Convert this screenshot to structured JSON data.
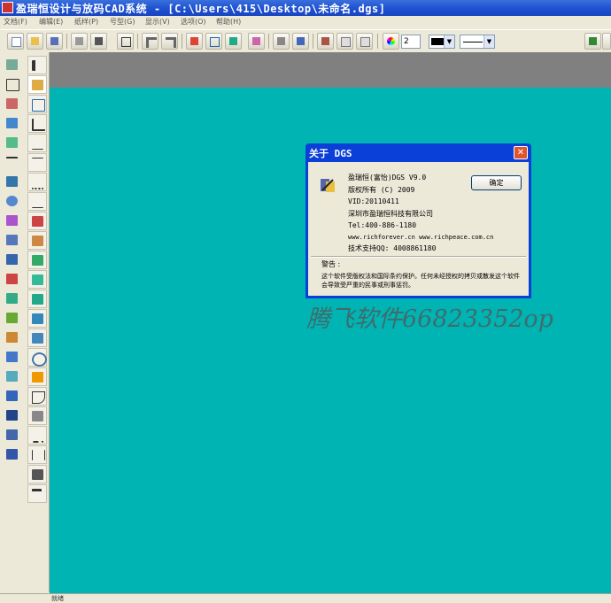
{
  "window": {
    "title": "盈瑞恒设计与放码CAD系统 - [C:\\Users\\415\\Desktop\\未命名.dgs]"
  },
  "menu": {
    "items": [
      "文档(F)",
      "编辑(E)",
      "纸样(P)",
      "号型(G)",
      "显示(V)",
      "选项(O)",
      "帮助(H)"
    ]
  },
  "toolbar": {
    "line_width_value": "2"
  },
  "dialog": {
    "title": "关于 DGS",
    "close_label": "✕",
    "product": "盈瑞恒(富怡)DGS V9.0",
    "copyright": "版权所有 (C) 2009",
    "vid": "VID:20110411",
    "company": "深圳市盈瑞恒科技有限公司",
    "tel": "Tel:400-886-1180",
    "web": "www.richforever.cn  www.richpeace.com.cn",
    "support": "技术支持QQ: 4008861180",
    "ok_label": "确定",
    "warning_label": "警告 :",
    "warning_text": "这个软件受版权法和国际条约保护。任何未经授权的拷贝或散发这个软件会导致受严重的民事或刑事惩罚。"
  },
  "watermark": "腾飞软件66823352op",
  "status": {
    "text": "就绪"
  },
  "colors": {
    "workspace": "#00b4b4",
    "titlebar": "#1c4ed0"
  }
}
